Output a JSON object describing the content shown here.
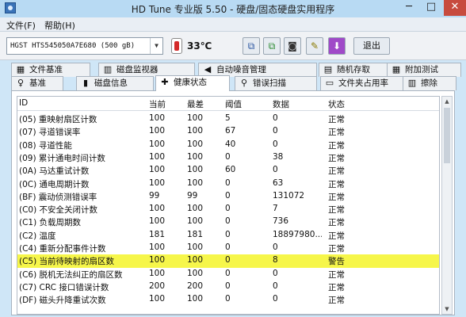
{
  "window": {
    "title": "HD Tune 专业版 5.50 - 硬盘/固态硬盘实用程序",
    "min_symbol": "─",
    "max_symbol": "□",
    "close_symbol": "✕"
  },
  "menu": [
    "文件(F)",
    "帮助(H)"
  ],
  "toolbar": {
    "drive": "HGST HTS545050A7E680 (500 gB)",
    "temperature": "33℃",
    "exit_label": "退出"
  },
  "tabs_row1": [
    {
      "label": "文件基准",
      "icon": "file-benchmark-icon",
      "glyph": "▦"
    },
    {
      "label": "磁盘监视器",
      "icon": "disk-monitor-icon",
      "glyph": "▥"
    },
    {
      "label": "自动噪音管理",
      "icon": "speaker-icon",
      "glyph": "◀"
    },
    {
      "label": "随机存取",
      "icon": "random-access-icon",
      "glyph": "▤"
    },
    {
      "label": "附加测试",
      "icon": "extra-tests-icon",
      "glyph": "▦"
    }
  ],
  "tabs_row2": [
    {
      "label": "基准",
      "icon": "benchmark-icon",
      "glyph": "♀"
    },
    {
      "label": "磁盘信息",
      "icon": "disk-info-icon",
      "glyph": "▮"
    },
    {
      "label": "健康状态",
      "icon": "health-cross-icon",
      "glyph": "✚",
      "active": true
    },
    {
      "label": "错误扫描",
      "icon": "error-scan-icon",
      "glyph": "⚲"
    },
    {
      "label": "文件夹占用率",
      "icon": "folder-usage-icon",
      "glyph": "▭"
    },
    {
      "label": "擦除",
      "icon": "erase-icon",
      "glyph": "▥"
    }
  ],
  "table": {
    "columns": [
      "ID",
      "当前",
      "最差",
      "阈值",
      "数据",
      "状态"
    ],
    "rows": [
      [
        "(05) 重映射扇区计数",
        "100",
        "100",
        "5",
        "0",
        "正常"
      ],
      [
        "(07) 寻道错误率",
        "100",
        "100",
        "67",
        "0",
        "正常"
      ],
      [
        "(08) 寻道性能",
        "100",
        "100",
        "40",
        "0",
        "正常"
      ],
      [
        "(09) 累计通电时间计数",
        "100",
        "100",
        "0",
        "38",
        "正常"
      ],
      [
        "(0A) 马达重试计数",
        "100",
        "100",
        "60",
        "0",
        "正常"
      ],
      [
        "(0C) 通电周期计数",
        "100",
        "100",
        "0",
        "63",
        "正常"
      ],
      [
        "(BF) 震动侦测错误率",
        "99",
        "99",
        "0",
        "131072",
        "正常"
      ],
      [
        "(C0) 不安全关闭计数",
        "100",
        "100",
        "0",
        "7",
        "正常"
      ],
      [
        "(C1) 负载周期数",
        "100",
        "100",
        "0",
        "736",
        "正常"
      ],
      [
        "(C2) 温度",
        "181",
        "181",
        "0",
        "18897980...",
        "正常"
      ],
      [
        "(C4) 重新分配事件计数",
        "100",
        "100",
        "0",
        "0",
        "正常"
      ],
      [
        "(C5) 当前待映射的扇区数",
        "100",
        "100",
        "0",
        "8",
        "警告"
      ],
      [
        "(C6) 脱机无法纠正的扇区数",
        "100",
        "100",
        "0",
        "0",
        "正常"
      ],
      [
        "(C7) CRC 接口错误计数",
        "200",
        "200",
        "0",
        "0",
        "正常"
      ],
      [
        "(DF) 磁头升降重试次数",
        "100",
        "100",
        "0",
        "0",
        "正常"
      ]
    ],
    "highlight_row": 11,
    "highlight_color": "#f6f64a"
  }
}
